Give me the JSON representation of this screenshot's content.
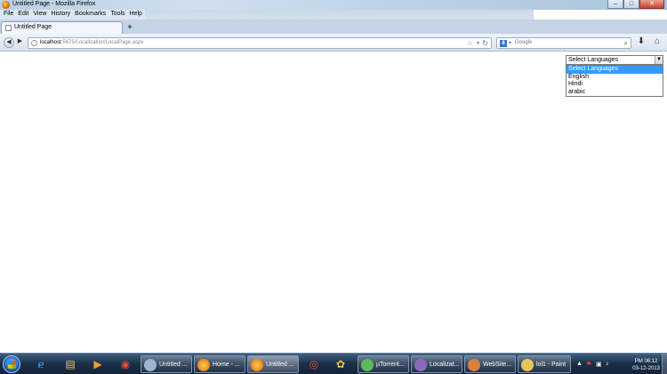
{
  "window": {
    "title": "Untitled Page - Mozilla Firefox",
    "minimize": "–",
    "maximize": "□",
    "close": "✕"
  },
  "menu": [
    "File",
    "Edit",
    "View",
    "History",
    "Bookmarks",
    "Tools",
    "Help"
  ],
  "tab": {
    "label": "Untitled Page",
    "new_tab": "+"
  },
  "nav": {
    "url_host": "localhost",
    "url_path": ":5675/Localization/LocalPage.aspx",
    "search_placeholder": "Google",
    "search_engine": "8"
  },
  "language_select": {
    "value": "Select Languages",
    "options": [
      "Select Languages",
      "English",
      "Hindi",
      "arabic"
    ],
    "selected_index": 0
  },
  "taskbar": {
    "tasks": [
      "Untitled ...",
      "Home - ...",
      "Untitled ...",
      "µTorrent...",
      "Localizat...",
      "WebSite...",
      "lol1 - Paint"
    ],
    "clock": {
      "time": "PM 06:12",
      "date": "03-12-2013"
    }
  },
  "colors": {
    "selection": "#3399ff",
    "taskbar": "#1b2f47"
  }
}
